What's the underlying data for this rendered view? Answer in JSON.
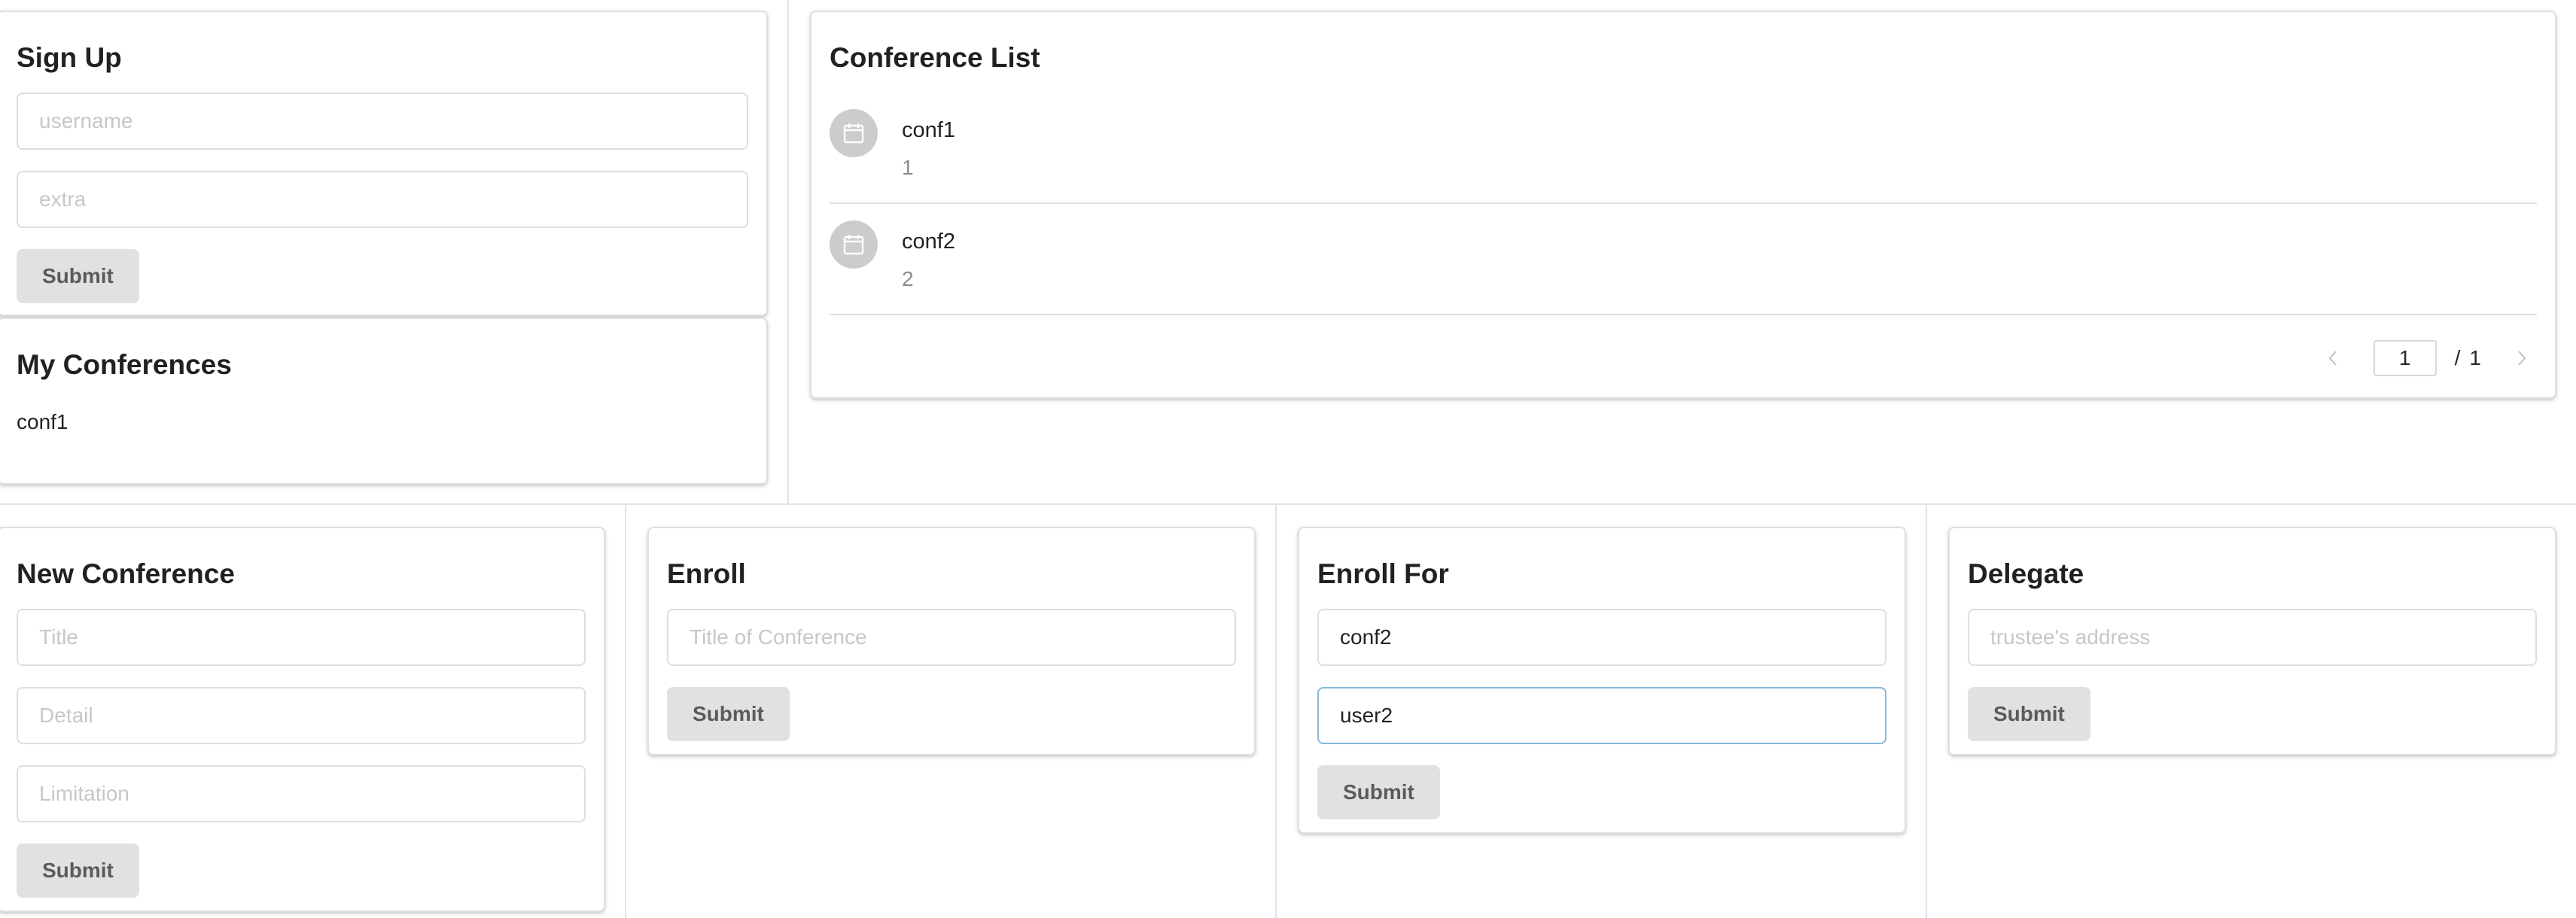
{
  "signup": {
    "title": "Sign Up",
    "username_placeholder": "username",
    "extra_placeholder": "extra",
    "submit_label": "Submit"
  },
  "my_conferences": {
    "title": "My Conferences",
    "items": [
      "conf1"
    ]
  },
  "conference_list": {
    "title": "Conference List",
    "items": [
      {
        "title": "conf1",
        "detail": "1"
      },
      {
        "title": "conf2",
        "detail": "2"
      }
    ],
    "pagination": {
      "current_page": "1",
      "separator": "/",
      "total_pages": "1"
    }
  },
  "new_conference": {
    "title": "New Conference",
    "title_placeholder": "Title",
    "detail_placeholder": "Detail",
    "limitation_placeholder": "Limitation",
    "submit_label": "Submit"
  },
  "enroll": {
    "title": "Enroll",
    "conference_placeholder": "Title of Conference",
    "submit_label": "Submit"
  },
  "enroll_for": {
    "title": "Enroll For",
    "conference_value": "conf2",
    "user_value": "user2",
    "submit_label": "Submit"
  },
  "delegate": {
    "title": "Delegate",
    "trustee_placeholder": "trustee's address",
    "submit_label": "Submit"
  },
  "icons": {
    "conference_avatar": "calendar-icon",
    "prev_page": "chevron-left-icon",
    "next_page": "chevron-right-icon"
  },
  "colors": {
    "button_bg": "#e0e1e2",
    "focus_border": "#85b7d9",
    "avatar_bg": "#cccccc"
  }
}
